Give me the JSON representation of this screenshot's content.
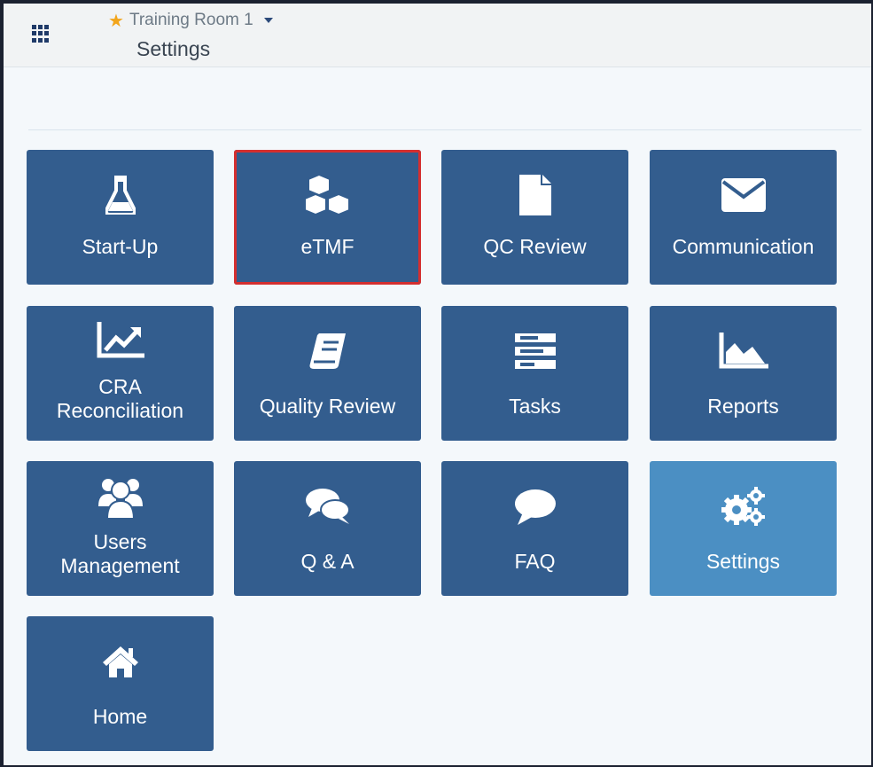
{
  "header": {
    "room_name": "Training Room 1",
    "page_title": "Settings",
    "star_color": "#f2a51b"
  },
  "tiles": [
    {
      "label": "Start-Up",
      "icon": "flask-icon"
    },
    {
      "label": "eTMF",
      "icon": "cubes-icon",
      "selected": true
    },
    {
      "label": "QC Review",
      "icon": "document-icon"
    },
    {
      "label": "Communication",
      "icon": "envelope-icon"
    },
    {
      "label_line1": "CRA",
      "label_line2": "Reconciliation",
      "icon": "line-chart-icon"
    },
    {
      "label": "Quality Review",
      "icon": "book-icon"
    },
    {
      "label": "Tasks",
      "icon": "tasks-list-icon"
    },
    {
      "label": "Reports",
      "icon": "area-chart-icon"
    },
    {
      "label_line1": "Users",
      "label_line2": "Management",
      "icon": "users-icon"
    },
    {
      "label": "Q & A",
      "icon": "comments-icon"
    },
    {
      "label": "FAQ",
      "icon": "comment-icon"
    },
    {
      "label": "Settings",
      "icon": "gears-icon",
      "active": true
    },
    {
      "label": "Home",
      "icon": "home-icon"
    }
  ],
  "colors": {
    "tile": "#335d8e",
    "tile_active": "#4b8fc3",
    "selected_outline": "#d42f2f"
  }
}
